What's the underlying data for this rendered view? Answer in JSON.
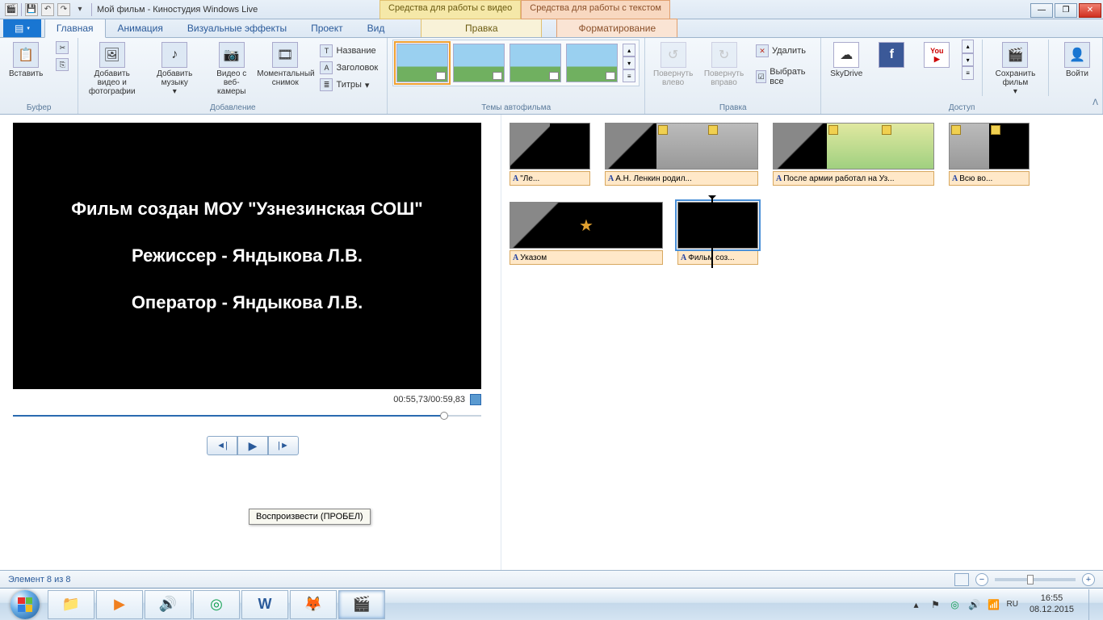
{
  "title": "Мой фильм - Киностудия Windows Live",
  "qat_icons": [
    "app",
    "save",
    "undo",
    "redo"
  ],
  "context_tabs": {
    "video": "Средства для работы с видео",
    "text": "Средства для работы с текстом"
  },
  "window_buttons": {
    "min": "—",
    "max": "❐",
    "close": "✕"
  },
  "ribbon_tabs": {
    "home": "Главная",
    "animation": "Анимация",
    "effects": "Визуальные эффекты",
    "project": "Проект",
    "view": "Вид",
    "edit_video": "Правка",
    "format_text": "Форматирование"
  },
  "ribbon": {
    "clipboard": {
      "label": "Буфер",
      "paste": "Вставить"
    },
    "add": {
      "label": "Добавление",
      "video_photo": "Добавить видео и фотографии",
      "music": "Добавить музыку",
      "webcam": "Видео с веб-камеры",
      "snapshot": "Моментальный снимок",
      "title": "Название",
      "caption": "Заголовок",
      "credits": "Титры"
    },
    "themes": {
      "label": "Темы автофильма"
    },
    "edit": {
      "label": "Правка",
      "rotate_left": "Повернуть влево",
      "rotate_right": "Повернуть вправо",
      "delete": "Удалить",
      "select_all": "Выбрать все"
    },
    "share": {
      "label": "Доступ",
      "skydrive": "SkyDrive",
      "save_movie": "Сохранить фильм",
      "signin": "Войти"
    }
  },
  "preview": {
    "line1": "Фильм создан МОУ \"Узнезинская СОШ\"",
    "line2": "Режиссер - Яндыкова Л.В.",
    "line3": "Оператор - Яндыкова Л.В.",
    "time": "00:55,73/00:59,83",
    "tooltip": "Воспроизвести (ПРОБЕЛ)"
  },
  "clips": [
    {
      "text": "\"Ле...",
      "wide": false
    },
    {
      "text": "А.Н. Ленкин родил...",
      "wide": true
    },
    {
      "text": "После армии работал на Уз...",
      "wide": true,
      "xwide": true
    },
    {
      "text": "Всю во...",
      "wide": false
    },
    {
      "text": "Указом",
      "wide": true
    },
    {
      "text": "Фильм соз...",
      "wide": false,
      "selected": true
    }
  ],
  "status": {
    "element": "Элемент 8 из 8"
  },
  "tray": {
    "time": "16:55",
    "date": "08.12.2015",
    "lang": "RU"
  }
}
